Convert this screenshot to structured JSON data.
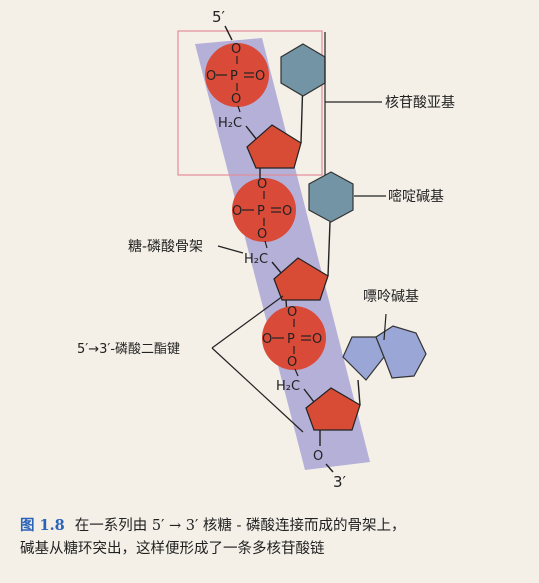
{
  "labels": {
    "five_prime": "5′",
    "three_prime": "3′",
    "nucleotide": "核苷酸亚基",
    "pyrimidine": "嘧啶碱基",
    "backbone": "糖-磷酸骨架",
    "purine": "嘌呤碱基",
    "phosphodiester": "5′→3′-磷酸二酯键"
  },
  "phosphate": {
    "o_top": "O",
    "p": "P",
    "o_right": "O",
    "o_left": "O",
    "o_bottom": "O"
  },
  "sugar": {
    "h2c": "H₂C"
  },
  "caption": {
    "label": "图 1.8",
    "line1": "在一系列由 5′ → 3′ 核糖 - 磷酸连接而成的骨架上，",
    "line2": "碱基从糖环突出，这样便形成了一条多核苷酸链"
  },
  "colors": {
    "backbone": "#b5b0d8",
    "phosphate": "#d94a38",
    "sugar": "#d84c36",
    "pyrimidine": "#7394a4",
    "purine": "#9aa6d6",
    "highlight_box": "#e38c98"
  }
}
